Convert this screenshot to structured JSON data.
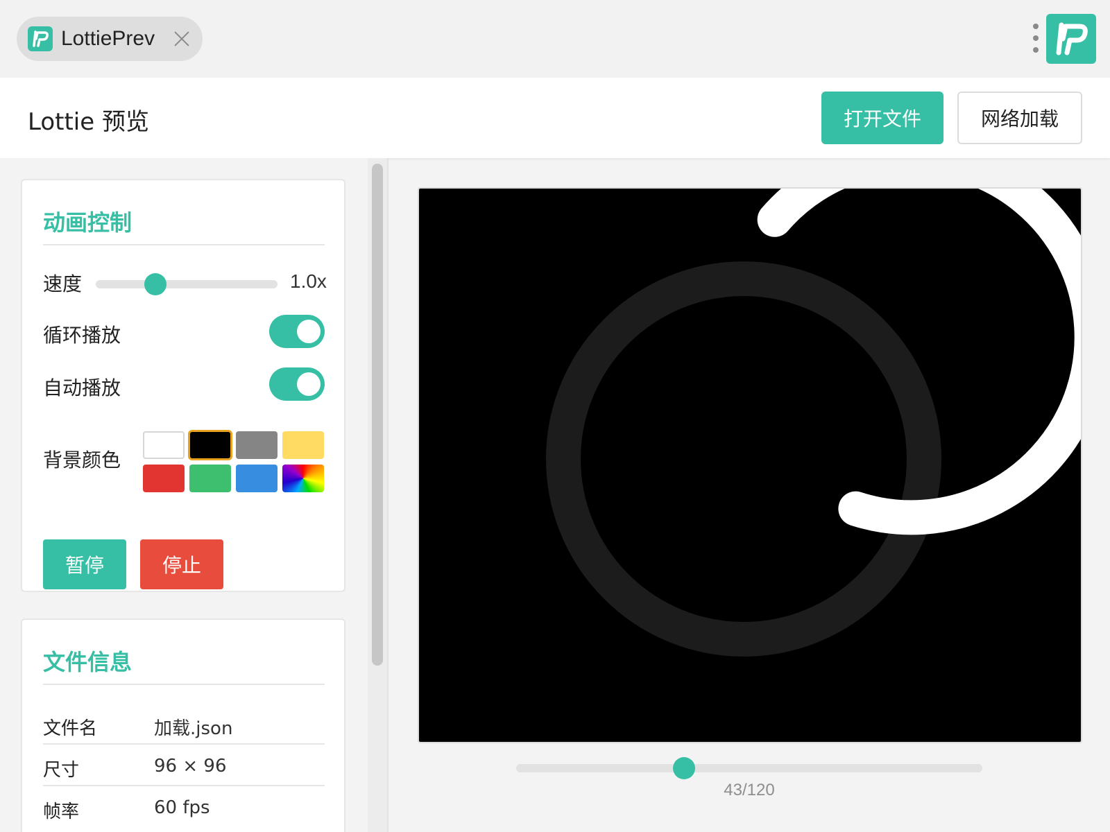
{
  "tab": {
    "title": "LottiePrev"
  },
  "header": {
    "title": "Lottie 预览",
    "open_file": "打开文件",
    "network_load": "网络加载"
  },
  "controls": {
    "title": "动画控制",
    "speed_label": "速度",
    "speed_value": "1.0x",
    "speed_level": 0.33,
    "loop_label": "循环播放",
    "loop_on": true,
    "autoplay_label": "自动播放",
    "autoplay_on": true,
    "bg_label": "背景颜色",
    "bg_colors": [
      "#ffffff",
      "#000000",
      "#858585",
      "#ffdb63",
      "#e23430",
      "#3dbf6f",
      "#378de0",
      "rainbow"
    ],
    "bg_selected": 1,
    "pause": "暂停",
    "stop": "停止"
  },
  "file_info": {
    "title": "文件信息",
    "rows": [
      {
        "key": "文件名",
        "value": "加载.json"
      },
      {
        "key": "尺寸",
        "value": "96 × 96"
      },
      {
        "key": "帧率",
        "value": "60 fps"
      }
    ]
  },
  "player": {
    "frame": 43,
    "total_frames": 120,
    "counter": "43/120",
    "progress": 0.36
  },
  "colors": {
    "accent": "#36bfa4",
    "danger": "#e74c3c"
  }
}
